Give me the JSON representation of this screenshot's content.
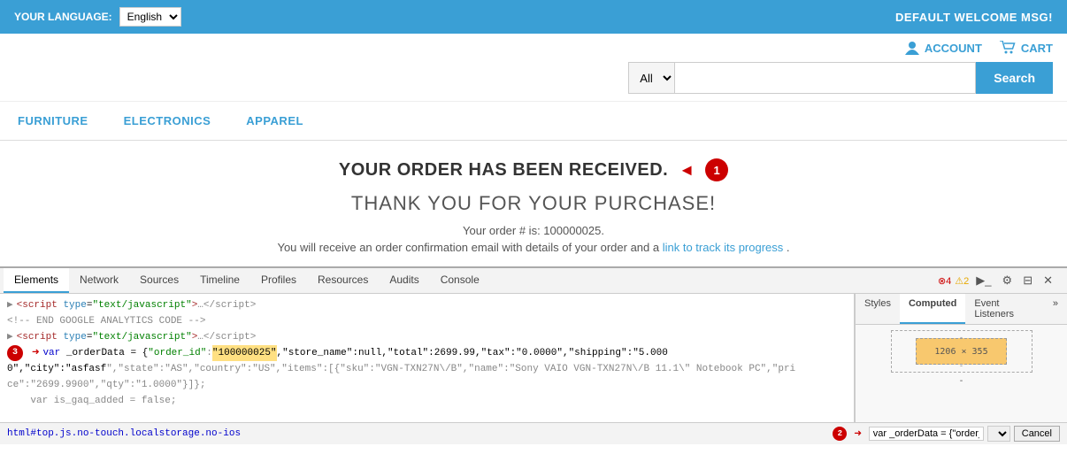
{
  "topbar": {
    "language_label": "YOUR LANGUAGE:",
    "language_value": "English",
    "welcome_msg": "DEFAULT WELCOME MSG!"
  },
  "header": {
    "account_label": "ACCOUNT",
    "cart_label": "CART",
    "search_placeholder": "",
    "search_button_label": "Search",
    "search_category": "All"
  },
  "nav": {
    "items": [
      {
        "label": "FURNITURE"
      },
      {
        "label": "ELECTRONICS"
      },
      {
        "label": "APPAREL"
      }
    ]
  },
  "main": {
    "order_received": "YOUR ORDER HAS BEEN RECEIVED.",
    "thank_you": "THANK YOU FOR YOUR PURCHASE!",
    "order_info_1": "Your order # is: 100000025.",
    "order_info_2": "You will receive an order confirmation email with details of your order and a",
    "order_info_link": "link to track its progress",
    "order_info_3": "."
  },
  "devtools": {
    "tabs": [
      "Elements",
      "Network",
      "Sources",
      "Timeline",
      "Profiles",
      "Resources",
      "Audits",
      "Console"
    ],
    "active_tab": "Elements",
    "error_count": "4",
    "warn_count": "2",
    "sidebar_tabs": [
      "Styles",
      "Computed",
      "Event Listeners"
    ],
    "active_sidebar_tab": "Computed",
    "dimension_label": "1206 × 355",
    "lines": [
      {
        "indent": 0,
        "content": "<script type=\"text/javascript\">…<\\/script>"
      },
      {
        "indent": 0,
        "content": "<!-- END GOOGLE ANALYTICS CODE -->"
      },
      {
        "indent": 0,
        "content": "<script type=\"text/javascript\">…<\\/script>"
      },
      {
        "indent": 0,
        "content": "var _orderData = {\"order_id\":\"100000025\",\"store_name\":null,\"total\":2699.99,\"tax\":\"0.0000\",\"shipping\":\"5.0000\",\"city\":\"asfasf\",\"state\":\"AS\",\"country\":\"US\",\"items\":[{\"sku\":\"VGN-TXN27N\\/B\",\"name\":\"Sony VAIO VGN-TXN27N\\/B 11.1\\\" Notebook PC\",\"price\":\"2699.9900\",\"qty\":\"1.0000\"}]};"
      },
      {
        "indent": 0,
        "content": "    var is_gaq_added = false;"
      }
    ],
    "bottom_path": "html#top.js.no-touch.localstorage.no-ios",
    "bottom_filter_value": "var _orderData = {\"order_id\":",
    "cancel_label": "Cancel"
  }
}
